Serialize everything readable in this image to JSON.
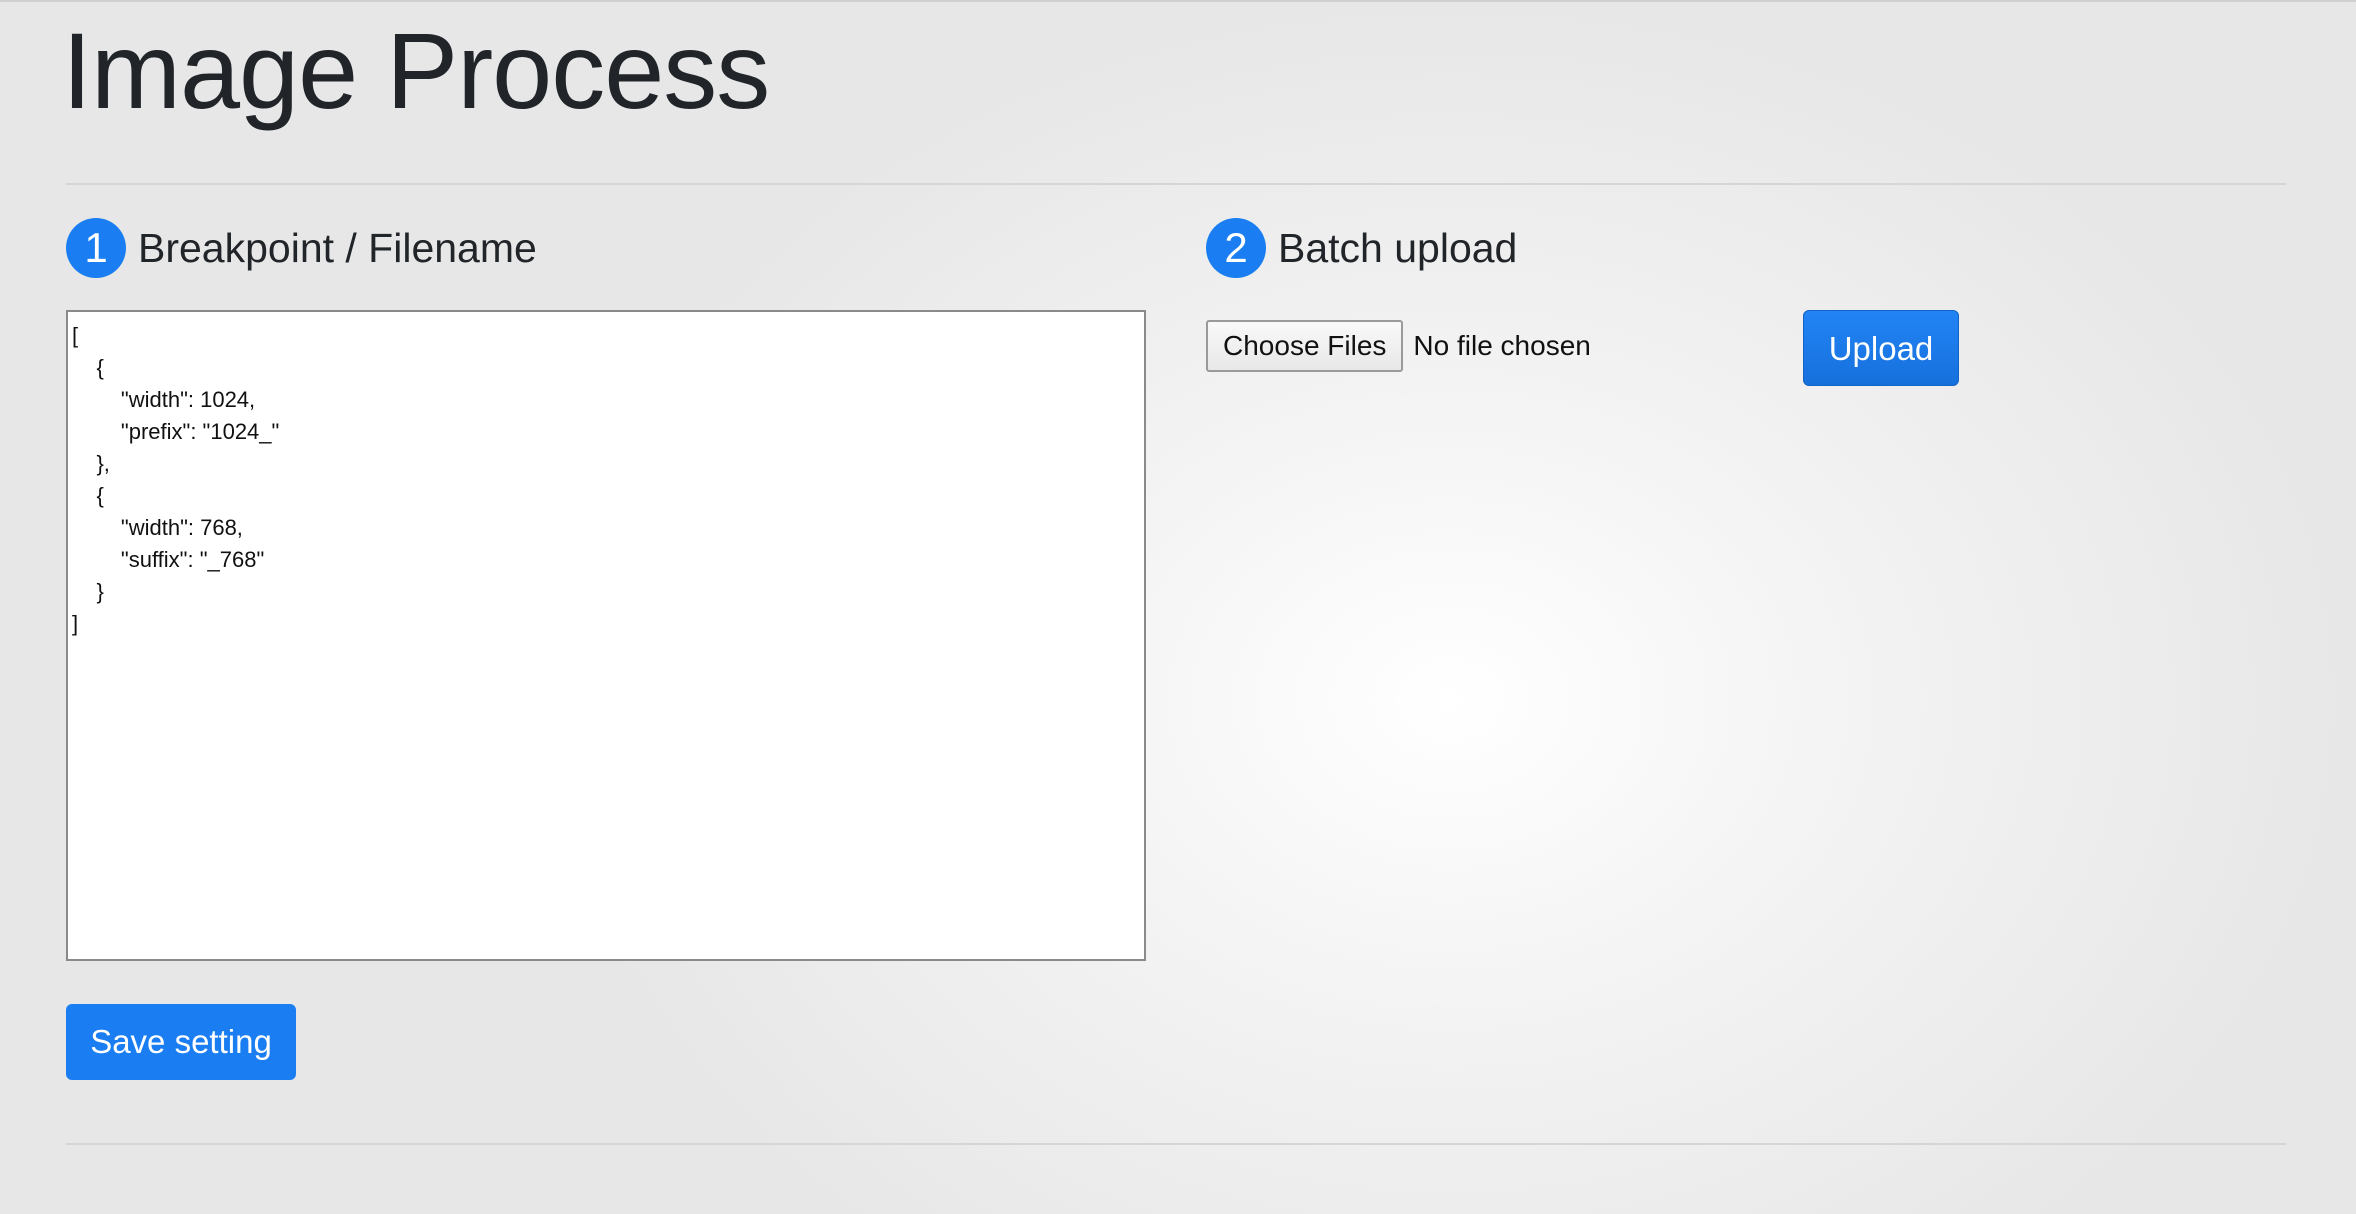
{
  "page": {
    "title": "Image Process"
  },
  "steps": [
    {
      "number": "1",
      "label": "Breakpoint / Filename"
    },
    {
      "number": "2",
      "label": "Batch upload"
    }
  ],
  "settings": {
    "json_value": "[\n    {\n        \"width\": 1024,\n        \"prefix\": \"1024_\"\n    },\n    {\n        \"width\": 768,\n        \"suffix\": \"_768\"\n    }\n]",
    "save_label": "Save setting"
  },
  "upload": {
    "choose_files_label": "Choose Files",
    "file_status": "No file chosen",
    "upload_label": "Upload"
  },
  "colors": {
    "primary": "#1a7ef2",
    "text": "#212529",
    "divider": "#d6d6d6"
  }
}
